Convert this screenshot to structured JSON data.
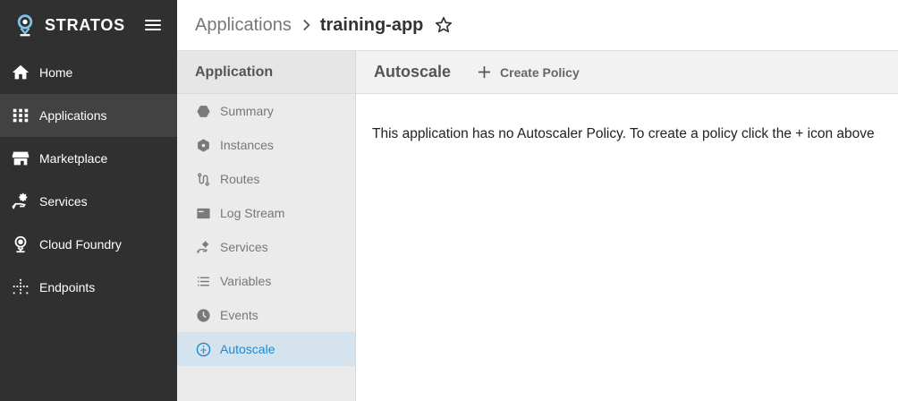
{
  "brand": {
    "name": "STRATOS",
    "logo_icon": "stratos-logo"
  },
  "sidenav": {
    "items": [
      {
        "label": "Home",
        "icon": "home-icon"
      },
      {
        "label": "Applications",
        "icon": "apps-grid-icon",
        "active": true
      },
      {
        "label": "Marketplace",
        "icon": "store-icon"
      },
      {
        "label": "Services",
        "icon": "service-hand-icon"
      },
      {
        "label": "Cloud Foundry",
        "icon": "cloud-foundry-icon"
      },
      {
        "label": "Endpoints",
        "icon": "endpoints-icon"
      }
    ]
  },
  "header": {
    "breadcrumb_parent": "Applications",
    "breadcrumb_separator": ">",
    "breadcrumb_current": "training-app"
  },
  "subnav": {
    "title": "Application",
    "items": [
      {
        "label": "Summary",
        "icon": "hexagon-icon"
      },
      {
        "label": "Instances",
        "icon": "instance-icon"
      },
      {
        "label": "Routes",
        "icon": "routes-icon"
      },
      {
        "label": "Log Stream",
        "icon": "log-stream-icon"
      },
      {
        "label": "Services",
        "icon": "service-hand-icon"
      },
      {
        "label": "Variables",
        "icon": "list-icon"
      },
      {
        "label": "Events",
        "icon": "clock-icon"
      },
      {
        "label": "Autoscale",
        "icon": "autoscale-icon",
        "active": true
      }
    ]
  },
  "main": {
    "title": "Autoscale",
    "create_label": "Create Policy",
    "message": "This application has no Autoscaler Policy. To create a policy click the + icon above"
  },
  "colors": {
    "sidenav_bg": "#303030",
    "sidenav_active": "#424242",
    "subnav_bg": "#ebebeb",
    "subnav_active_bg": "#d5e3ee",
    "accent": "#1e88d2"
  }
}
